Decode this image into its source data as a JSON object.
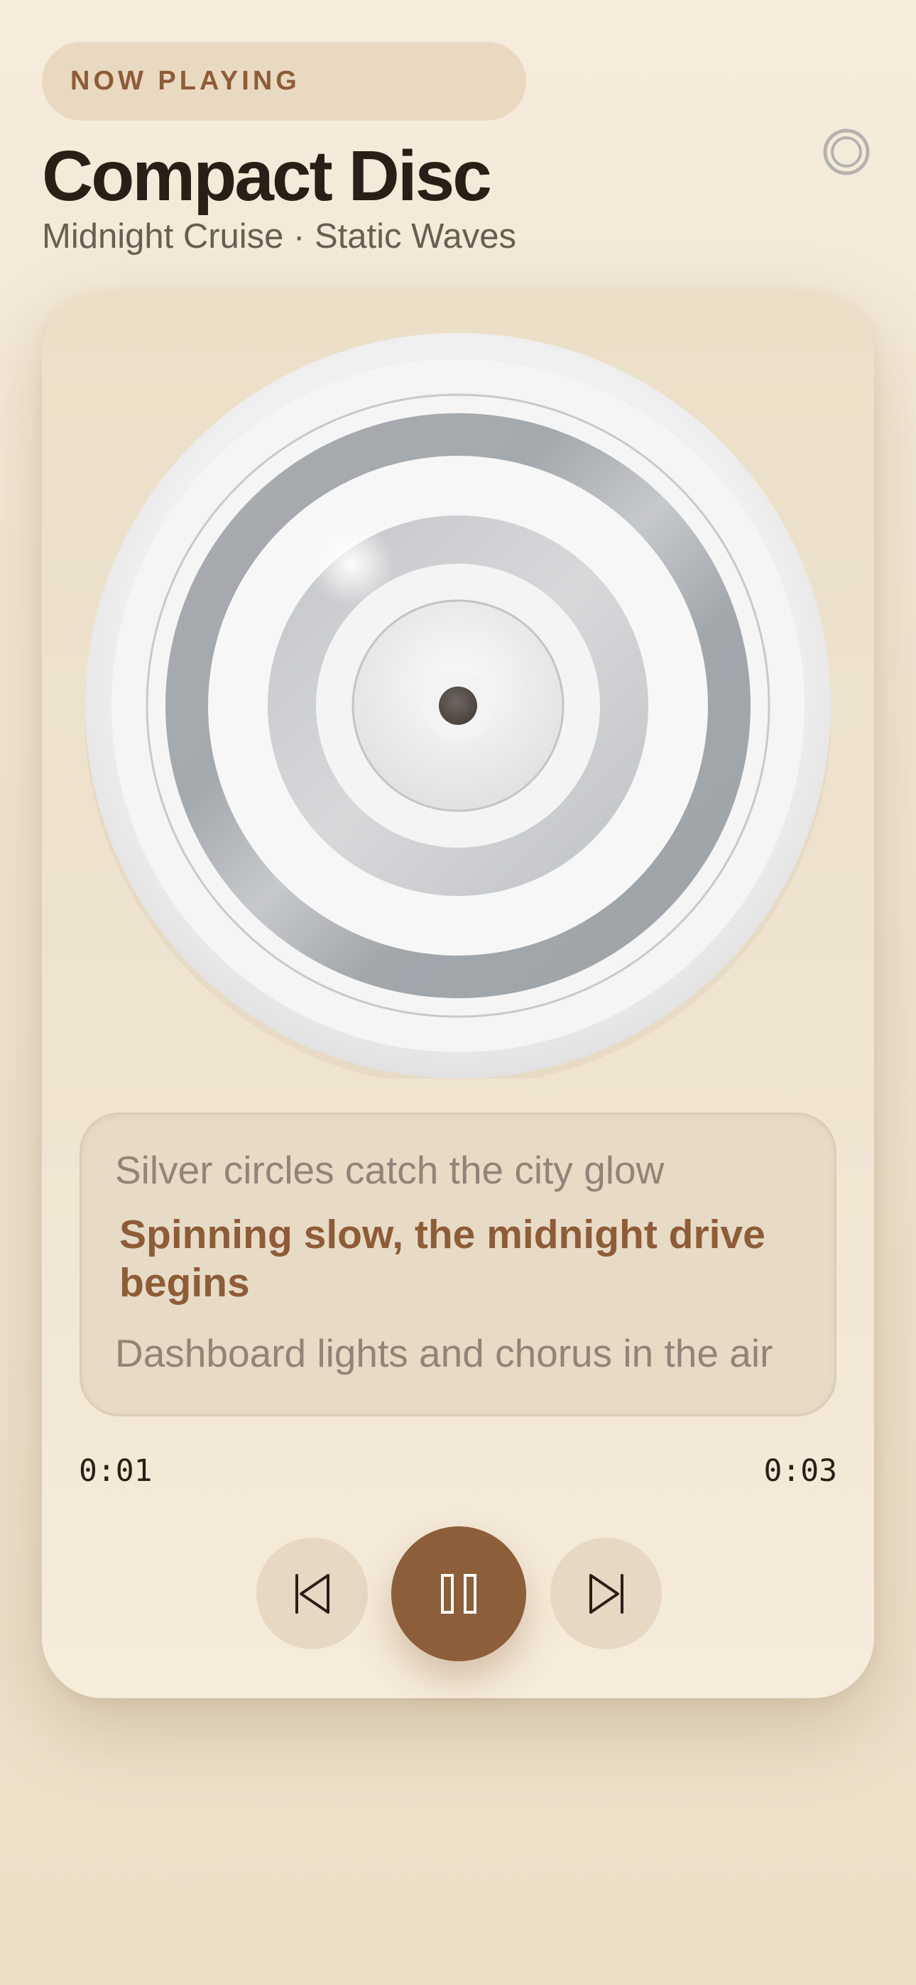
{
  "header": {
    "badge": "NOW PLAYING",
    "title": "Compact Disc",
    "subtitle": "Midnight Cruise · Static Waves"
  },
  "icons": {
    "settings": "target-ring-icon",
    "previous": "skip-previous-icon",
    "play_pause": "pause-icon",
    "next": "skip-next-icon"
  },
  "lyrics": {
    "previous": "Silver circles catch the city glow",
    "current": "Spinning slow, the midnight drive begins",
    "next": "Dashboard lights and chorus in the air"
  },
  "playback": {
    "elapsed": "0:01",
    "total": "0:03",
    "state": "playing"
  },
  "colors": {
    "accent": "#8c5e3a",
    "background": "#f6ecdc",
    "text_primary": "#2a1f17",
    "text_secondary": "#6a5d51",
    "lyric_dim": "#918478"
  }
}
